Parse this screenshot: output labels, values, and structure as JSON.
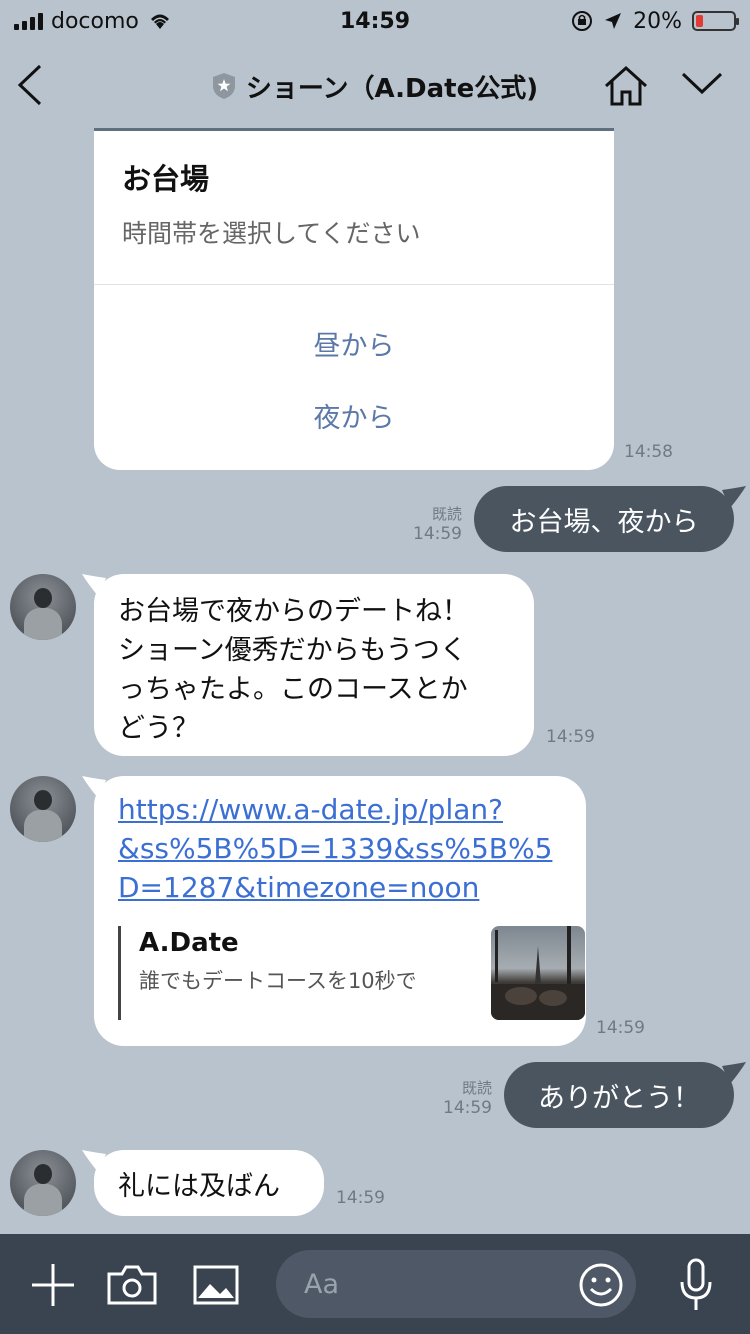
{
  "status": {
    "carrier": "docomo",
    "time": "14:59",
    "battery": "20%",
    "battery_level": 0.2
  },
  "header": {
    "title": "ショーン（A.Date公式)"
  },
  "menu": {
    "title": "お台場",
    "subtitle": "時間帯を選択してください",
    "options": [
      "昼から",
      "夜から"
    ],
    "time": "14:58"
  },
  "messages": {
    "out1": {
      "text": "お台場、夜から",
      "read": "既読",
      "time": "14:59"
    },
    "in1": {
      "lines": [
        "お台場で夜からのデートね！",
        "ショーン優秀だからもうつく",
        "っちゃたよ。このコースとか",
        "どう？"
      ],
      "time": "14:59"
    },
    "in2": {
      "link_lines": [
        "https://www.a-date.jp/plan?",
        "&ss%5B%5D=1339&ss%5B%5",
        "D=1287&timezone=noon"
      ],
      "preview_title": "A.Date",
      "preview_desc": "誰でもデートコースを10秒で",
      "time": "14:59"
    },
    "out2": {
      "text": "ありがとう！",
      "read": "既読",
      "time": "14:59"
    },
    "in3": {
      "text": "礼には及ばん",
      "time": "14:59"
    }
  },
  "composer": {
    "placeholder": "Aa"
  },
  "colors": {
    "background": "#b9c3cd",
    "outgoing_bubble": "#4a5560",
    "bottom_bar": "#3a4350",
    "link": "#3b6fd4",
    "menu_option": "#5b79a8"
  }
}
